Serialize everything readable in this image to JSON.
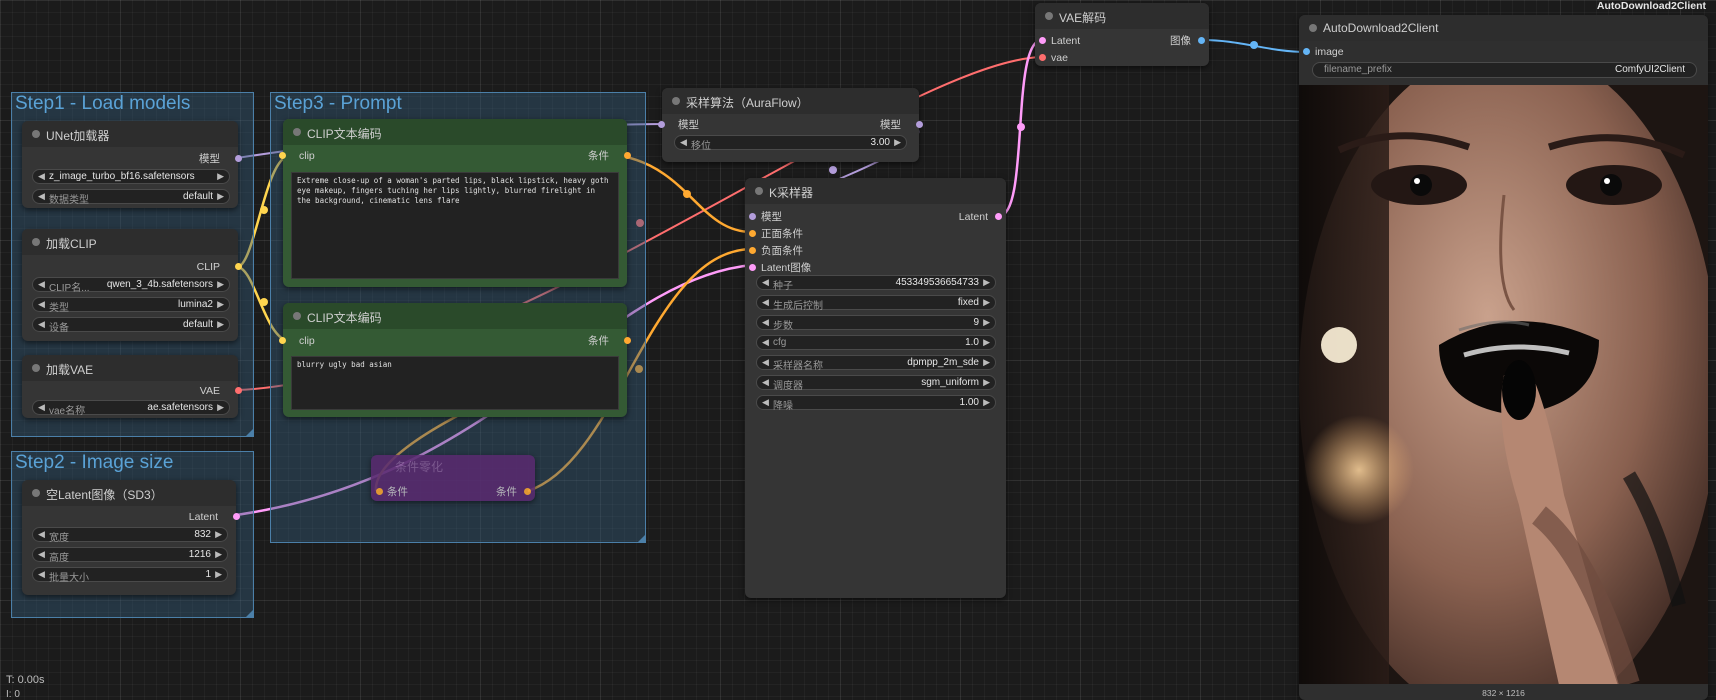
{
  "header": {
    "top_right_label": "AutoDownload2Client"
  },
  "groups": {
    "step1": "Step1 - Load models",
    "step2": "Step2 - Image size",
    "step3": "Step3 - Prompt"
  },
  "nodes": {
    "unet": {
      "title": "UNet加载器",
      "output": "模型",
      "widgets": [
        {
          "value": "z_image_turbo_bf16.safetensors"
        },
        {
          "name": "数据类型",
          "value": "default"
        }
      ]
    },
    "clip_loader": {
      "title": "加载CLIP",
      "output": "CLIP",
      "widgets": [
        {
          "name": "CLIP名...",
          "value": "qwen_3_4b.safetensors"
        },
        {
          "name": "类型",
          "value": "lumina2"
        },
        {
          "name": "设备",
          "value": "default"
        }
      ]
    },
    "vae_loader": {
      "title": "加载VAE",
      "output": "VAE",
      "widgets": [
        {
          "name": "vae名称",
          "value": "ae.safetensors"
        }
      ]
    },
    "latent": {
      "title": "空Latent图像（SD3）",
      "output": "Latent",
      "widgets": [
        {
          "name": "宽度",
          "value": "832"
        },
        {
          "name": "高度",
          "value": "1216"
        },
        {
          "name": "批量大小",
          "value": "1"
        }
      ]
    },
    "clip_pos": {
      "title": "CLIP文本编码",
      "input": "clip",
      "output": "条件",
      "text": "Extreme close-up of a woman's parted lips, black lipstick, heavy goth eye makeup, fingers tuching her lips lightly, blurred firelight in the background, cinematic lens flare"
    },
    "clip_neg": {
      "title": "CLIP文本编码",
      "input": "clip",
      "output": "条件",
      "text": "blurry ugly bad asian"
    },
    "zero_cond": {
      "title": "条件零化",
      "input": "条件",
      "output": "条件"
    },
    "auraflow": {
      "title": "采样算法（AuraFlow）",
      "input": "模型",
      "output": "模型",
      "widgets": [
        {
          "name": "移位",
          "value": "3.00"
        }
      ]
    },
    "ksampler": {
      "title": "K采样器",
      "inputs": [
        "模型",
        "正面条件",
        "负面条件",
        "Latent图像"
      ],
      "output": "Latent",
      "widgets": [
        {
          "name": "种子",
          "value": "453349536654733"
        },
        {
          "name": "生成后控制",
          "value": "fixed"
        },
        {
          "name": "步数",
          "value": "9"
        },
        {
          "name": "cfg",
          "value": "1.0"
        },
        {
          "name": "采样器名称",
          "value": "dpmpp_2m_sde"
        },
        {
          "name": "调度器",
          "value": "sgm_uniform"
        },
        {
          "name": "降噪",
          "value": "1.00"
        }
      ]
    },
    "vae_decode": {
      "title": "VAE解码",
      "inputs": [
        "Latent",
        "vae"
      ],
      "output": "图像"
    },
    "autodl": {
      "title": "AutoDownload2Client",
      "input": "image",
      "widget": {
        "name": "filename_prefix",
        "value": "ComfyUI2Client"
      },
      "image_size": "832 × 1216"
    }
  },
  "status": {
    "time": "T: 0.00s",
    "i": "I: 0"
  },
  "colors": {
    "model": "#b39ddb",
    "clip": "#ffd54f",
    "vae": "#ff6e6e",
    "latent": "#ff9cf9",
    "conditioning": "#ffa931",
    "image": "#64b5f6"
  }
}
